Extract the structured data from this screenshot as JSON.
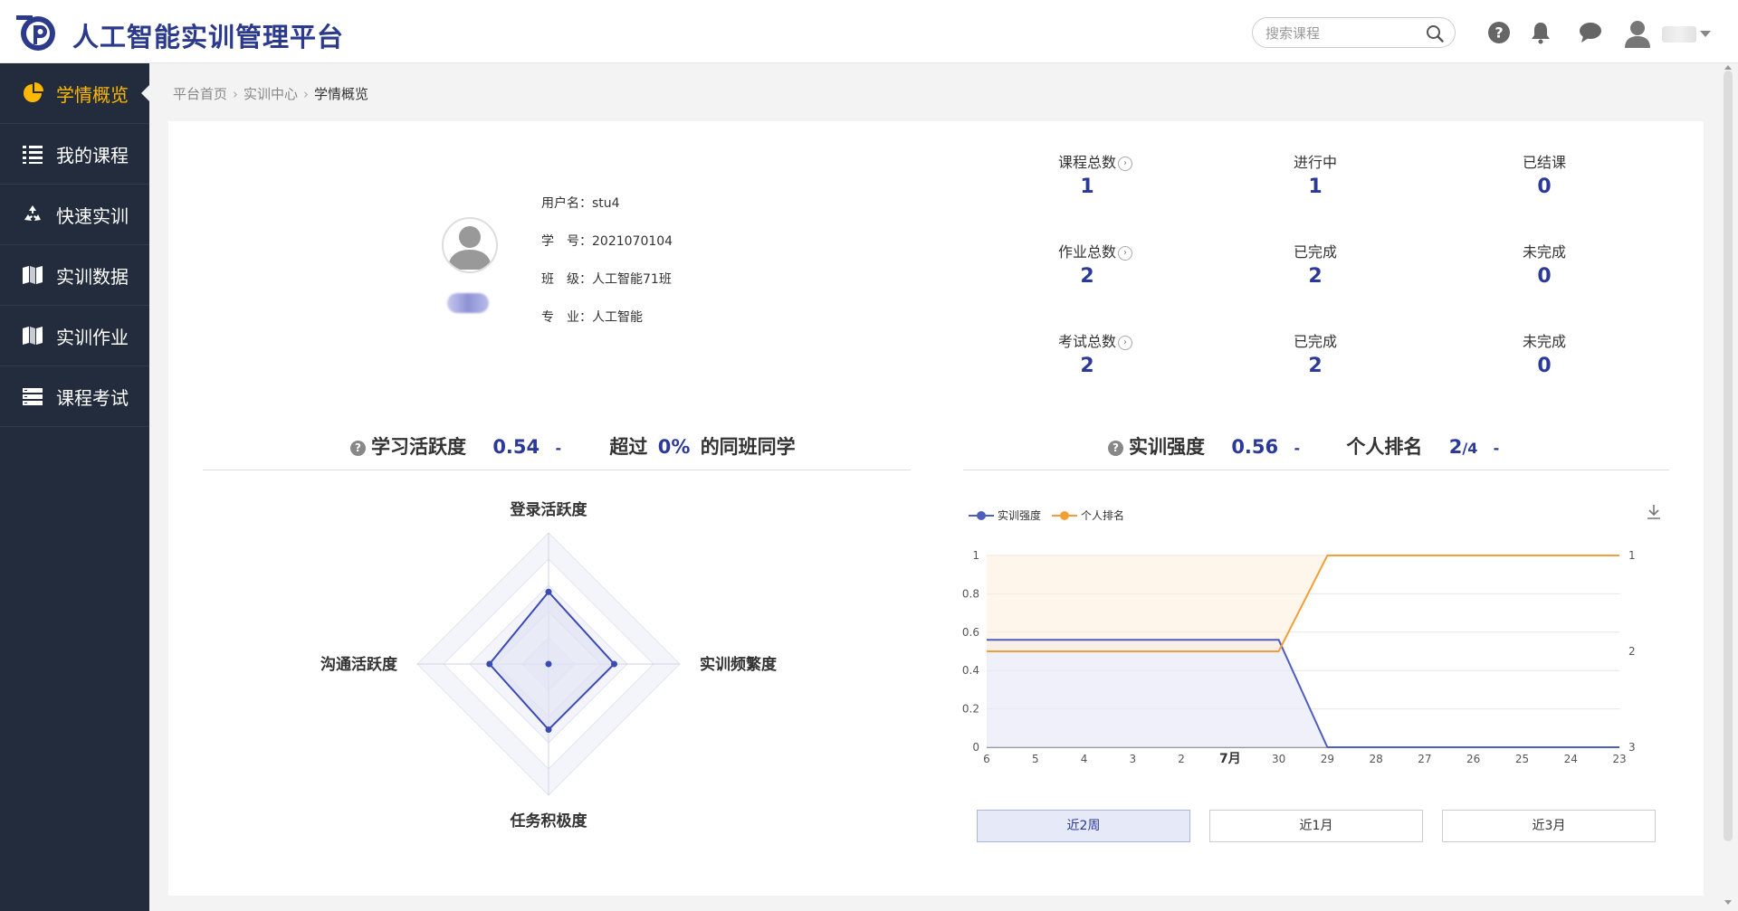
{
  "header": {
    "title": "人工智能实训管理平台",
    "search_placeholder": "搜索课程"
  },
  "sidebar": {
    "items": [
      {
        "label": "学情概览",
        "icon": "pie-chart-icon"
      },
      {
        "label": "我的课程",
        "icon": "list-icon"
      },
      {
        "label": "快速实训",
        "icon": "recycle-icon"
      },
      {
        "label": "实训数据",
        "icon": "map-icon"
      },
      {
        "label": "实训作业",
        "icon": "map-icon"
      },
      {
        "label": "课程考试",
        "icon": "stack-icon"
      }
    ]
  },
  "breadcrumb": [
    "平台首页",
    "实训中心",
    "学情概览"
  ],
  "profile": {
    "username_label": "用户名：",
    "username": "stu4",
    "id_label": "学　号：",
    "id": "2021070104",
    "class_label": "班　级：",
    "class": "人工智能71班",
    "major_label": "专　业：",
    "major": "人工智能"
  },
  "stats": [
    {
      "label": "课程总数",
      "value": "1",
      "link": true
    },
    {
      "label": "进行中",
      "value": "1",
      "link": false
    },
    {
      "label": "已结课",
      "value": "0",
      "link": false
    },
    {
      "label": "作业总数",
      "value": "2",
      "link": true
    },
    {
      "label": "已完成",
      "value": "2",
      "link": false
    },
    {
      "label": "未完成",
      "value": "0",
      "link": false
    },
    {
      "label": "考试总数",
      "value": "2",
      "link": true
    },
    {
      "label": "已完成",
      "value": "2",
      "link": false
    },
    {
      "label": "未完成",
      "value": "0",
      "link": false
    }
  ],
  "activity": {
    "title": "学习活跃度",
    "score": "0.54",
    "dash": "-",
    "exceed_prefix": "超过",
    "exceed_value": "0%",
    "exceed_suffix": "的同班同学"
  },
  "training": {
    "title": "实训强度",
    "score": "0.56",
    "dash": "-",
    "rank_title": "个人排名",
    "rank": "2",
    "rank_total": "/4",
    "dash2": "-"
  },
  "chart_data": [
    {
      "type": "radar",
      "indicators": [
        "登录活跃度",
        "实训频繁度",
        "任务积极度",
        "沟通活跃度"
      ],
      "max": 1,
      "values": [
        0.55,
        0.5,
        0.5,
        0.45
      ],
      "colors": {
        "line": "#3a4ab5",
        "area": "#dfe2f4",
        "grid": "#e9ebf5"
      }
    },
    {
      "type": "line",
      "legend": [
        "实训强度",
        "个人排名"
      ],
      "legend_position": "top-left",
      "x": [
        "6",
        "5",
        "4",
        "3",
        "2",
        "7月",
        "30",
        "29",
        "28",
        "27",
        "26",
        "25",
        "24",
        "23"
      ],
      "series": [
        {
          "name": "实训强度",
          "color": "#4e5fbb",
          "values": [
            0.56,
            0.56,
            0.56,
            0.56,
            0.56,
            0.56,
            0.56,
            0,
            0,
            0,
            0,
            0,
            0,
            0
          ],
          "axis": "left"
        },
        {
          "name": "个人排名",
          "color": "#f0a036",
          "values": [
            2,
            2,
            2,
            2,
            2,
            2,
            2,
            1,
            1,
            1,
            1,
            1,
            1,
            1
          ],
          "axis": "right"
        }
      ],
      "y_left": {
        "min": 0,
        "max": 1,
        "ticks": [
          "0",
          "0.2",
          "0.4",
          "0.6",
          "0.8",
          "1"
        ]
      },
      "y_right": {
        "min": 1,
        "max": 3,
        "inverse": true,
        "ticks": [
          "1",
          "2",
          "3"
        ]
      },
      "grid": true
    }
  ],
  "range_buttons": [
    {
      "label": "近2周",
      "active": true
    },
    {
      "label": "近1月",
      "active": false
    },
    {
      "label": "近3月",
      "active": false
    }
  ]
}
